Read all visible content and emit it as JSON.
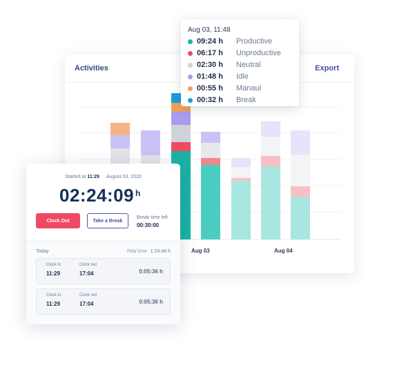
{
  "activities": {
    "title": "Activities",
    "export_label": "Export",
    "dates": [
      "Aug 03",
      "Aug 04"
    ]
  },
  "colors": {
    "productive": "#19b3a6",
    "unproductive": "#ef4a5d",
    "neutral": "#cfd2d8",
    "idle": "#a99cf0",
    "manual": "#f0a25a",
    "break": "#1d9bdc"
  },
  "tooltip": {
    "datetime": "Aug 03, 11:48",
    "items": [
      {
        "value": "09:24 h",
        "label": "Productive",
        "color": "#19b3a6"
      },
      {
        "value": "06:17 h",
        "label": "Unproductive",
        "color": "#ef4a5d"
      },
      {
        "value": "02:30 h",
        "label": "Neutral",
        "color": "#cfd2d8"
      },
      {
        "value": "01:48 h",
        "label": "Idle",
        "color": "#a99cf0"
      },
      {
        "value": "00:55 h",
        "label": "Manaul",
        "color": "#f0a25a"
      },
      {
        "value": "00:32 h",
        "label": "Break",
        "color": "#1d9bdc"
      }
    ]
  },
  "timer": {
    "started_label": "Started at",
    "started_time": "11:29",
    "started_date": "August 03, 2020",
    "clock": "02:24:09",
    "clock_unit": "h",
    "clock_out_label": "Clock Out",
    "take_break_label": "Take a Break",
    "break_time_left_label": "Break time left",
    "break_time_left_value": "00:30:00",
    "today_label": "Today",
    "total_time_label": "Total time",
    "total_time_value": "1:24:48 h",
    "entries": [
      {
        "clock_in_label": "Clock in",
        "clock_in": "11:29",
        "clock_out_label": "Clock out",
        "clock_out": "17:04",
        "duration": "0:05:36 h"
      },
      {
        "clock_in_label": "Clock in",
        "clock_in": "11:29",
        "clock_out_label": "Clock out",
        "clock_out": "17:04",
        "duration": "0:05:36 h"
      }
    ]
  }
}
